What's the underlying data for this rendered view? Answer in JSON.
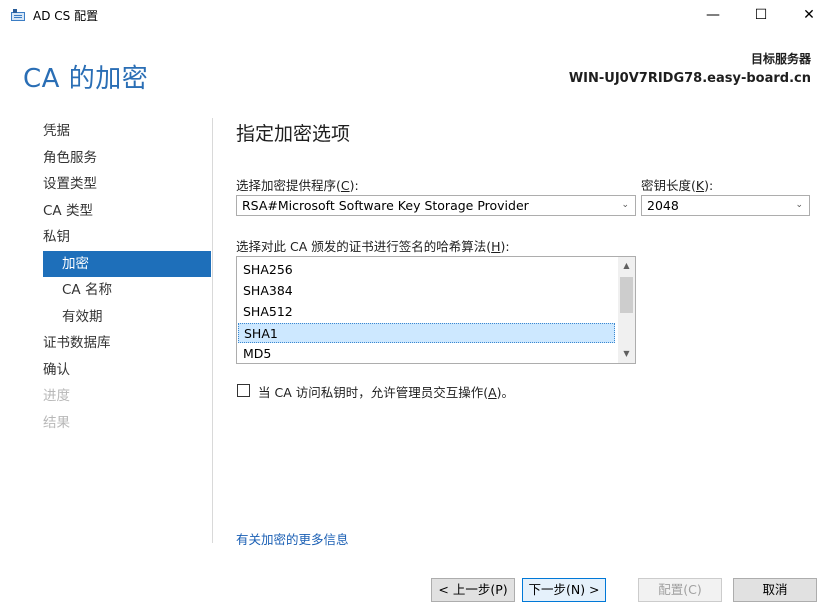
{
  "window": {
    "title": "AD CS 配置",
    "minimize": "—",
    "maximize": "☐",
    "close": "✕"
  },
  "header": {
    "title": "CA 的加密",
    "target_label": "目标服务器",
    "target_value": "WIN-UJ0V7RIDG78.easy-board.cn"
  },
  "sidebar": {
    "items": [
      {
        "label": "凭据",
        "state": "normal",
        "level": 0
      },
      {
        "label": "角色服务",
        "state": "normal",
        "level": 0
      },
      {
        "label": "设置类型",
        "state": "normal",
        "level": 0
      },
      {
        "label": "CA 类型",
        "state": "normal",
        "level": 0
      },
      {
        "label": "私钥",
        "state": "normal",
        "level": 0
      },
      {
        "label": "加密",
        "state": "selected",
        "level": 1
      },
      {
        "label": "CA 名称",
        "state": "normal",
        "level": 1
      },
      {
        "label": "有效期",
        "state": "normal",
        "level": 1
      },
      {
        "label": "证书数据库",
        "state": "normal",
        "level": 0
      },
      {
        "label": "确认",
        "state": "normal",
        "level": 0
      },
      {
        "label": "进度",
        "state": "disabled",
        "level": 0
      },
      {
        "label": "结果",
        "state": "disabled",
        "level": 0
      }
    ]
  },
  "main": {
    "section_title": "指定加密选项",
    "provider_label_prefix": "选择加密提供程序(",
    "provider_label_key": "C",
    "provider_label_suffix": "):",
    "provider_value": "RSA#Microsoft Software Key Storage Provider",
    "keylen_label_prefix": "密钥长度(",
    "keylen_label_key": "K",
    "keylen_label_suffix": "):",
    "keylen_value": "2048",
    "hash_label_prefix": "选择对此 CA 颁发的证书进行签名的哈希算法(",
    "hash_label_key": "H",
    "hash_label_suffix": "):",
    "hash_items": [
      "SHA256",
      "SHA384",
      "SHA512",
      "SHA1",
      "MD5"
    ],
    "hash_selected": "SHA1",
    "checkbox_label_prefix": "当 CA 访问私钥时，允许管理员交互操作(",
    "checkbox_label_key": "A",
    "checkbox_label_suffix": ")。",
    "checkbox_checked": false,
    "more_link": "有关加密的更多信息"
  },
  "buttons": {
    "back": "< 上一步(P)",
    "next": "下一步(N) >",
    "configure": "配置(C)",
    "cancel": "取消"
  },
  "colors": {
    "accent": "#1e6fba",
    "title": "#2a6eb5",
    "link": "#1a5fb4"
  }
}
